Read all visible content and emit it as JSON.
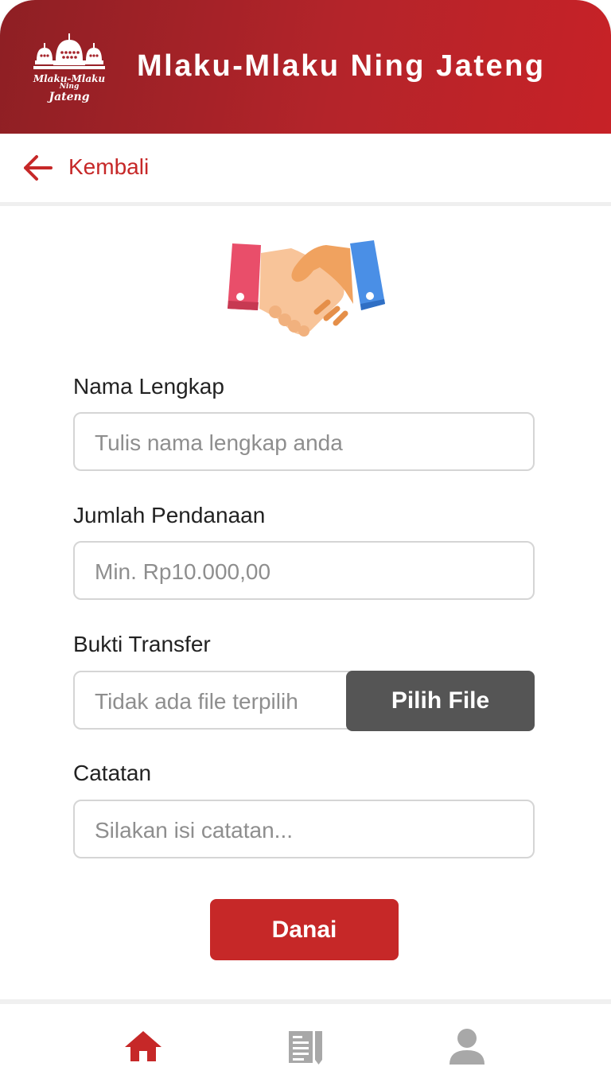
{
  "header": {
    "title": "Mlaku-Mlaku Ning Jateng",
    "logo_icon": "temple-logo-icon",
    "logo_text": [
      "Mlaku-Mlaku",
      "Ning",
      "Jateng"
    ]
  },
  "back": {
    "label": "Kembali",
    "icon": "arrow-left-icon"
  },
  "illustration": "handshake-icon",
  "form": {
    "name": {
      "label": "Nama Lengkap",
      "placeholder": "Tulis nama lengkap anda"
    },
    "amount": {
      "label": "Jumlah Pendanaan",
      "placeholder": "Min. Rp10.000,00"
    },
    "proof": {
      "label": "Bukti Transfer",
      "status": "Tidak ada file terpilih",
      "button": "Pilih File"
    },
    "notes": {
      "label": "Catatan",
      "placeholder": "Silakan isi catatan..."
    },
    "submit": "Danai"
  },
  "bottom_nav": [
    {
      "icon": "home-icon",
      "active": true
    },
    {
      "icon": "news-icon",
      "active": false
    },
    {
      "icon": "profile-icon",
      "active": false
    }
  ],
  "colors": {
    "primary": "#c62828",
    "header_dark": "#8e1f24",
    "button_dark": "#555555",
    "nav_inactive": "#a8a8a8"
  }
}
